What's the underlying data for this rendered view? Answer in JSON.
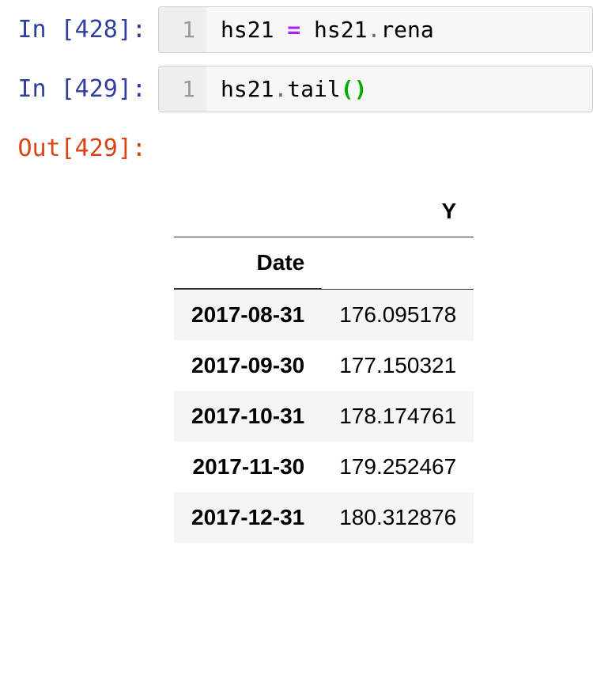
{
  "cells": {
    "first": {
      "prompt": "In [428]:",
      "line_no": "1",
      "tokens": {
        "var": "hs21",
        "eq": " = ",
        "rhs_var": "hs21",
        "dot": ".",
        "attr": "rena"
      }
    },
    "second": {
      "prompt": "In [429]:",
      "line_no": "1",
      "tokens": {
        "var": "hs21",
        "dot": ".",
        "attr": "tail",
        "lp": "(",
        "rp": ")"
      }
    },
    "out": {
      "prompt": "Out[429]:"
    }
  },
  "dataframe": {
    "columns": [
      "Y"
    ],
    "index_name": "Date",
    "rows": [
      {
        "index": "2017-08-31",
        "Y": "176.095178"
      },
      {
        "index": "2017-09-30",
        "Y": "177.150321"
      },
      {
        "index": "2017-10-31",
        "Y": "178.174761"
      },
      {
        "index": "2017-11-30",
        "Y": "179.252467"
      },
      {
        "index": "2017-12-31",
        "Y": "180.312876"
      }
    ]
  }
}
